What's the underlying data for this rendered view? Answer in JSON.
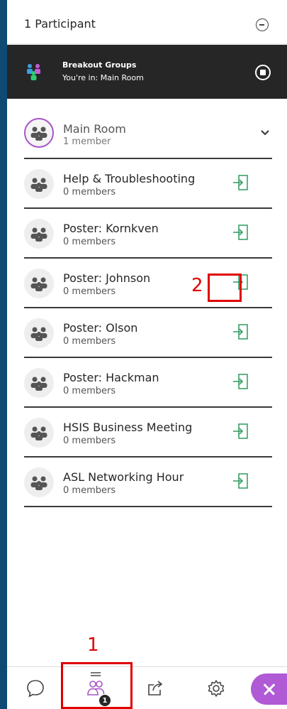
{
  "header": {
    "title": "1 Participant"
  },
  "banner": {
    "title": "Breakout Groups",
    "subtitle": "You're in: Main Room"
  },
  "main_room": {
    "name": "Main Room",
    "count": "1 member"
  },
  "groups": [
    {
      "name": "Help & Troubleshooting",
      "count": "0 members"
    },
    {
      "name": "Poster: Kornkven",
      "count": "0 members"
    },
    {
      "name": "Poster: Johnson",
      "count": "0 members"
    },
    {
      "name": "Poster: Olson",
      "count": "0 members"
    },
    {
      "name": "Poster: Hackman",
      "count": "0 members"
    },
    {
      "name": "HSIS Business Meeting",
      "count": "0 members"
    },
    {
      "name": "ASL Networking Hour",
      "count": "0 members"
    }
  ],
  "annotations": {
    "step1": "1",
    "step2": "2"
  },
  "nav": {
    "attendees_badge": "1"
  },
  "colors": {
    "accent": "#a855c8",
    "join_green": "#2e9a5e",
    "annotation_red": "#e00000",
    "banner_bg": "#262626"
  }
}
